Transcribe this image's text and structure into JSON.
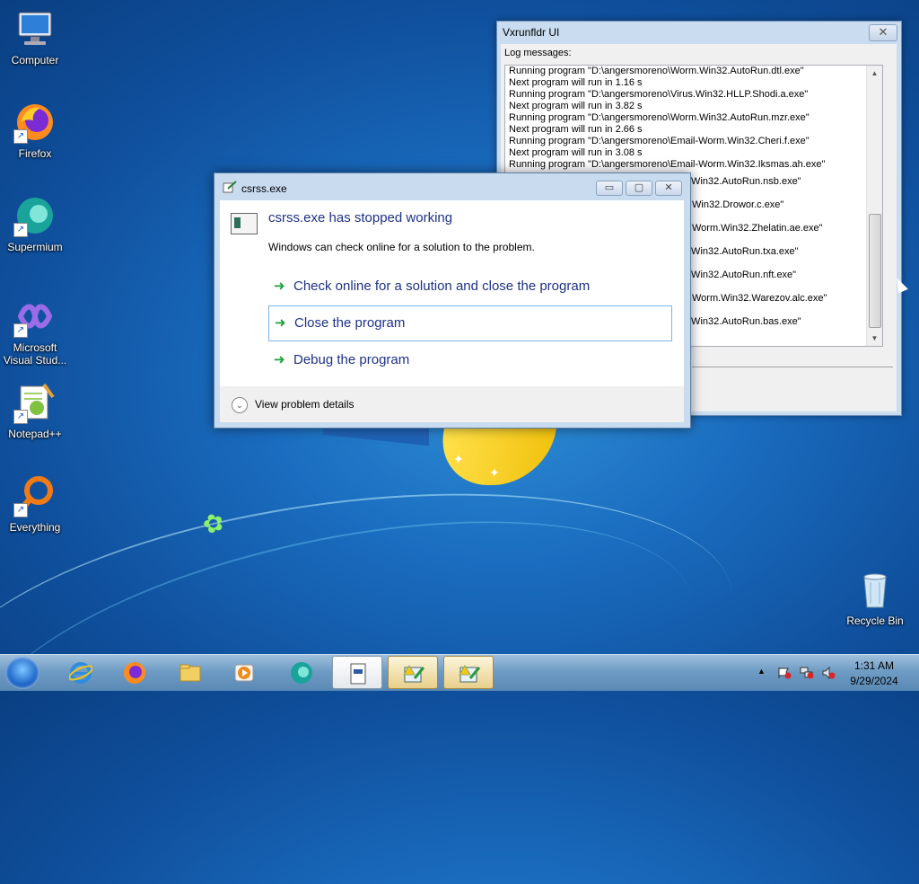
{
  "desktop": {
    "icons": [
      {
        "label": "Computer",
        "icon": "computer-icon"
      },
      {
        "label": "Firefox",
        "icon": "firefox-icon"
      },
      {
        "label": "Supermium",
        "icon": "supermium-icon"
      },
      {
        "label": "Microsoft Visual Stud...",
        "icon": "visual-studio-icon"
      },
      {
        "label": "Notepad++",
        "icon": "notepad-plus-plus-icon"
      },
      {
        "label": "Everything",
        "icon": "everything-search-icon"
      },
      {
        "label": "Recycle Bin",
        "icon": "recycle-bin-icon"
      }
    ]
  },
  "vxwindow": {
    "title": "Vxrunfldr UI",
    "close_glyph": "✕",
    "log_label": "Log messages:",
    "log_lines": [
      "Running program \"D:\\angersmoreno\\Worm.Win32.AutoRun.dtl.exe\"",
      "Next program will run in 1.16 s",
      "Running program \"D:\\angersmoreno\\Virus.Win32.HLLP.Shodi.a.exe\"",
      "Next program will run in 3.82 s",
      "Running program \"D:\\angersmoreno\\Worm.Win32.AutoRun.mzr.exe\"",
      "Next program will run in 2.66 s",
      "Running program \"D:\\angersmoreno\\Email-Worm.Win32.Cheri.f.exe\"",
      "Next program will run in 3.08 s",
      "Running program \"D:\\angersmoreno\\Email-Worm.Win32.Iksmas.ah.exe\""
    ],
    "hidden_fragments": [
      ".Win32.AutoRun.nsb.exe\"",
      "Win32.Drowor.c.exe\"",
      "Worm.Win32.Zhelatin.ae.exe\"",
      ".Win32.AutoRun.txa.exe\"",
      ".Win32.AutoRun.nft.exe\"",
      "Worm.Win32.Warezov.alc.exe\"",
      ".Win32.AutoRun.bas.exe\""
    ]
  },
  "dialog": {
    "title": "csrss.exe",
    "heading": "csrss.exe has stopped working",
    "subtext": "Windows can check online for a solution to the problem.",
    "options": [
      {
        "label": "Check online for a solution and close the program",
        "selected": false
      },
      {
        "label": "Close the program",
        "selected": true
      },
      {
        "label": "Debug the program",
        "selected": false
      }
    ],
    "details_label": "View problem details",
    "btn_min": "▭",
    "btn_max": "▢",
    "btn_close": "✕",
    "arrow_glyph": "➜"
  },
  "taskbar": {
    "apps": [
      {
        "name": "internet-explorer",
        "open": false
      },
      {
        "name": "firefox",
        "open": false
      },
      {
        "name": "file-explorer",
        "open": false
      },
      {
        "name": "media-player",
        "open": false
      },
      {
        "name": "supermium",
        "open": false
      },
      {
        "name": "document-app",
        "open": true
      },
      {
        "name": "warning-app-1",
        "open": true
      },
      {
        "name": "warning-app-2",
        "open": true
      }
    ],
    "time": "1:31 AM",
    "date": "9/29/2024"
  },
  "colors": {
    "accent_blue": "#1e3287",
    "option_green": "#1e9e3a"
  }
}
